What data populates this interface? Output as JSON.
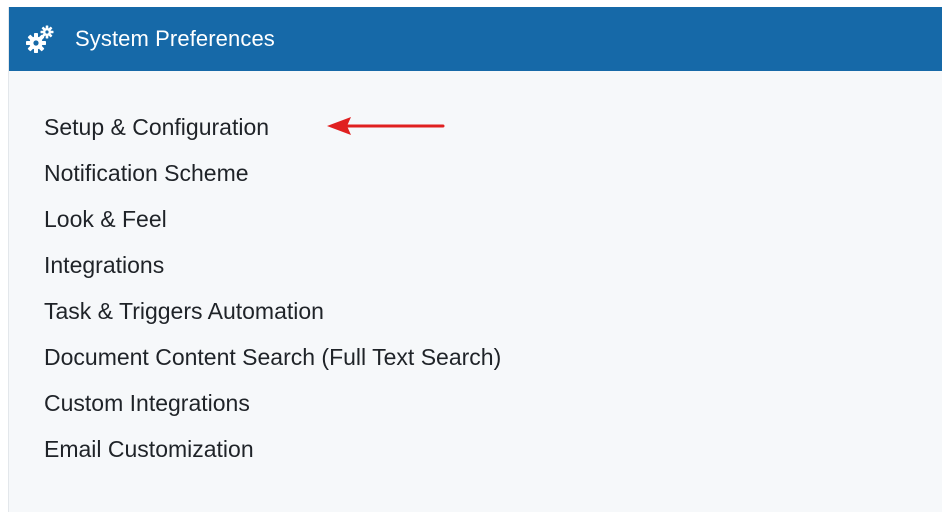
{
  "header": {
    "title": "System Preferences",
    "icon": "gears-icon",
    "background_color": "#1669a8"
  },
  "menu": {
    "items": [
      {
        "label": "Setup & Configuration"
      },
      {
        "label": "Notification Scheme"
      },
      {
        "label": "Look & Feel"
      },
      {
        "label": "Integrations"
      },
      {
        "label": "Task & Triggers Automation"
      },
      {
        "label": "Document Content Search (Full Text Search)"
      },
      {
        "label": "Custom Integrations"
      },
      {
        "label": "Email Customization"
      }
    ]
  },
  "annotation": {
    "icon": "red-arrow-icon",
    "color": "#e02020"
  }
}
